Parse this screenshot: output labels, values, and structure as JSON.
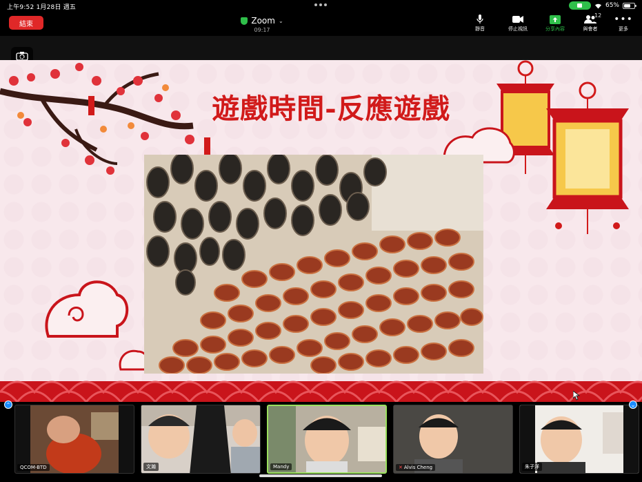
{
  "status_bar": {
    "time_date": "上午9:52   1月28日 週五",
    "battery": "65%",
    "battery_level": 0.65
  },
  "top_bar": {
    "end_label": "結束",
    "meeting_title": "Zoom",
    "elapsed": "09:17",
    "controls": {
      "mute": "靜音",
      "stop_video": "停止視訊",
      "share": "分享內容",
      "participants": "與會者",
      "participant_count": "12",
      "more": "更多"
    }
  },
  "slide": {
    "title": "遊戲時間-反應遊戲"
  },
  "gallery": {
    "tiles": [
      {
        "name": "QCOM-BTD",
        "muted": false
      },
      {
        "name": "文瀚",
        "muted": false
      },
      {
        "name": "Mandy",
        "muted": false
      },
      {
        "name": "Alvis Cheng",
        "muted": true
      },
      {
        "name": "朱子洋",
        "muted": false
      }
    ],
    "page_prev": "⌃",
    "page_next": "⌄"
  },
  "icons": {
    "accent_green": "#2fbf4a",
    "end_red": "#e02828",
    "active_tile_border": "#9be15d"
  }
}
